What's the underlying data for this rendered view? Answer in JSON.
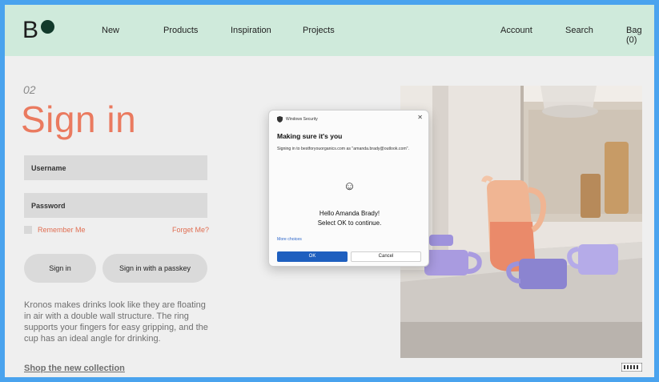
{
  "logo": {
    "letter": "B"
  },
  "nav": {
    "left": [
      "New",
      "Products",
      "Inspiration",
      "Projects"
    ],
    "right": [
      "Account",
      "Search",
      "Bag (0)"
    ]
  },
  "signin": {
    "step": "02",
    "title": "Sign in",
    "username_label": "Username",
    "password_label": "Password",
    "remember_label": "Remember Me",
    "forgot_label": "Forget Me?",
    "signin_button": "Sign in",
    "passkey_button": "Sign in with a passkey",
    "description": "Kronos makes drinks look like they are floating in air with a double wall structure. The ring supports your fingers for easy gripping, and the cup has an ideal angle for drinking.",
    "shop_link": "Shop the new collection"
  },
  "dialog": {
    "header": "Windows Security",
    "close_symbol": "✕",
    "title": "Making sure it's you",
    "body": "Signing in to bestforyouorganics.com as \"amanda.brady@outlook.com\".",
    "face_symbol": "☺",
    "greeting_line1": "Hello Amanda Brady!",
    "greeting_line2": "Select OK to continue.",
    "more_choices": "More choices",
    "ok_label": "OK",
    "cancel_label": "Cancel"
  },
  "colors": {
    "accent": "#ea7a5f",
    "header_bg": "#cfeadb",
    "dialog_primary": "#1e5fbf",
    "frame_border": "#4aa3ee"
  },
  "icons": [
    "shield-icon",
    "close-icon",
    "smiley-face-icon",
    "checkbox-icon",
    "badge-icon"
  ]
}
